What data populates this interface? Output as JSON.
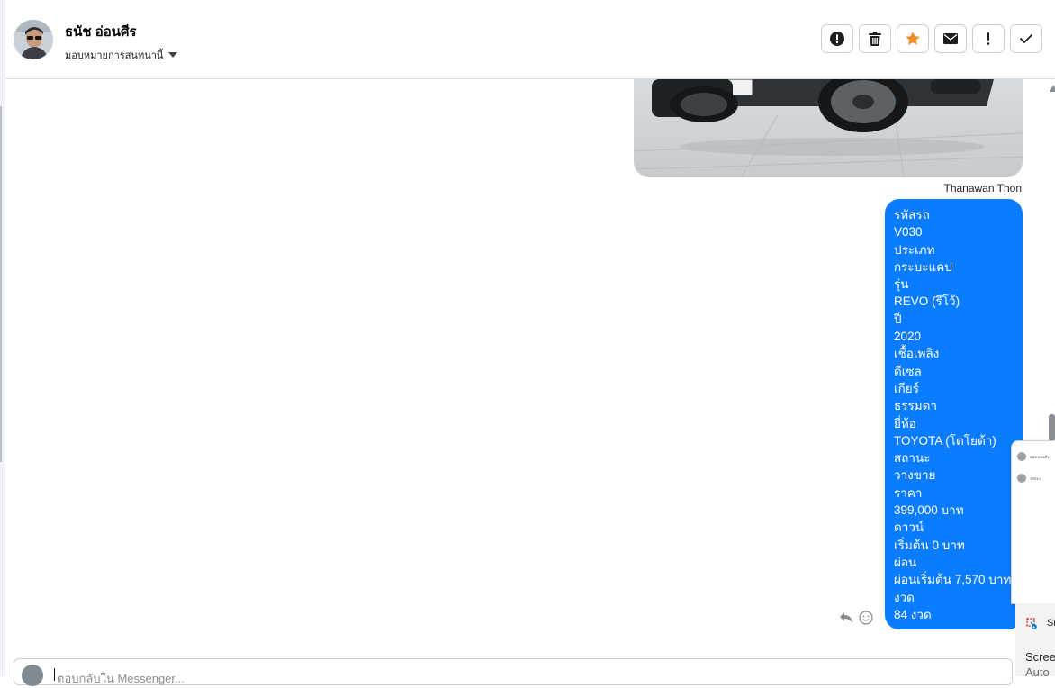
{
  "header": {
    "contact_name": "ธนัช อ่อนศีร",
    "assign_label": "มอบหมายการสนทนานี้",
    "tools": [
      {
        "icon": "alert-circle-icon"
      },
      {
        "icon": "trash-icon"
      },
      {
        "icon": "star-icon",
        "color": "#f28b24"
      },
      {
        "icon": "envelope-icon"
      },
      {
        "icon": "exclamation-icon"
      },
      {
        "icon": "check-icon"
      }
    ]
  },
  "conversation": {
    "sender_name": "Thanawan Thon",
    "message_lines": [
      "รหัสรถ",
      "V030",
      "ประเภท",
      "กระบะแคป",
      "รุ่น",
      "REVO (รีโว้)",
      "ปี",
      "2020",
      "เชื้อเพลิง",
      "ดีเซล",
      "เกียร์",
      "ธรรมดา",
      "ยี่ห้อ",
      "TOYOTA (โตโยต้า)",
      "สถานะ",
      "วางขาย",
      "ราคา",
      "399,000 บาท",
      "ดาวน์",
      "เริ่มต้น 0 บาท",
      "ผ่อน",
      "ผ่อนเริ่มต้น 7,570 บาท",
      "งวด",
      "84 งวด"
    ],
    "bubble_color": "#0a7cff"
  },
  "snip": {
    "label": "Sn",
    "line1": "Scree",
    "line2": "Auto"
  },
  "popup": {
    "row1": "ธนัช อ่อนศีร",
    "row2": "รหัสรถ"
  },
  "composer": {
    "placeholder": "ตอบกลับใน Messenger..."
  }
}
